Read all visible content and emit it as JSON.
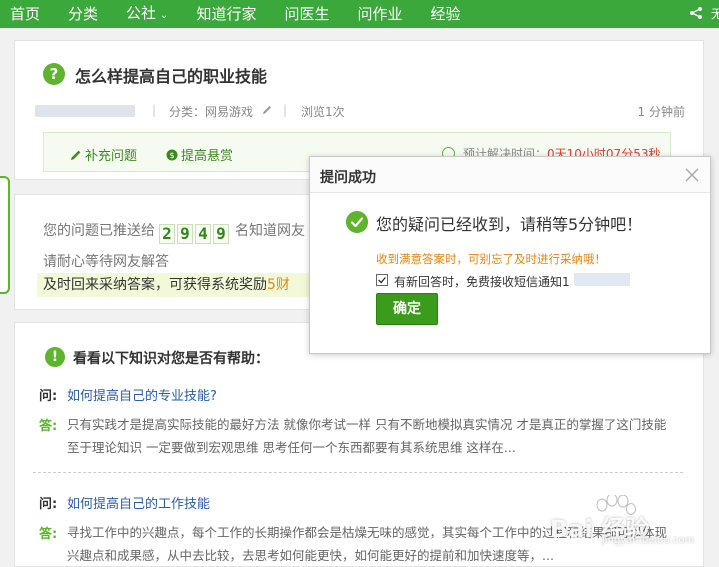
{
  "nav": {
    "items": [
      "首页",
      "分类",
      "公社",
      "知道行家",
      "问医生",
      "问作业",
      "经验"
    ],
    "more_label": "无"
  },
  "question": {
    "title": "怎么样提高自己的职业技能",
    "category": "分类：网易游戏",
    "views": "浏览1次",
    "time": "1 分钟前",
    "supplement_label": "补充问题",
    "reward_label": "提高悬赏",
    "countdown_label": "预计解决时间：",
    "countdown_value": "0天10小时07分53秒"
  },
  "notify": {
    "line1_prefix": "您的问题已推送给",
    "digits": [
      "2",
      "9",
      "4",
      "9"
    ],
    "line1_suffix": "名知道网友",
    "line2": "请耐心等待网友解答",
    "line3_prefix": "及时回来采纳答案，可获得系统奖励",
    "line3_suffix": "5财"
  },
  "related": {
    "title": "看看以下知识对您是否有帮助：",
    "q_label": "问:",
    "a_label": "答:",
    "items": [
      {
        "question": "如何提高自己的专业技能?",
        "answer": "只有实践才是提高实际技能的最好方法 就像你考试一样 只有不断地模拟真实情况 才是真正的掌握了这门技能 至于理论知识 一定要做到宏观思维 思考任何一个东西都要有其系统思维 这样在..."
      },
      {
        "question": "如何提高自己的工作技能",
        "answer": "寻找工作中的兴趣点，每个工作的长期操作都会是枯燥无味的感觉，其实每个工作中的过程和结果都可以体现兴趣点和成果感，从中去比较，去思考如何能更快，如何能更好的提前和加快速度等，..."
      }
    ]
  },
  "modal": {
    "title": "提问成功",
    "success": "您的疑问已经收到，请稍等5分钟吧！",
    "tip": "收到满意答案时，可别忘了及时进行采纳哦！",
    "checkbox_label": "有新回答时，免费接收短信通知1",
    "ok_label": "确定"
  },
  "watermark": {
    "brand": "Bai  经验",
    "sub": "jingyan.baidu.com"
  },
  "colors": {
    "brand_green": "#3ba83b",
    "accent_orange": "#e9860c",
    "countdown_red": "#e43d2f",
    "link_blue": "#2a5caa"
  }
}
